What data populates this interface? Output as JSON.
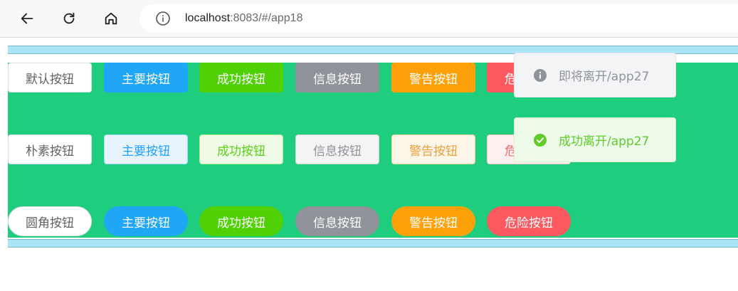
{
  "browser": {
    "url_host": "localhost",
    "url_rest": ":8083/#/app18"
  },
  "rows": [
    {
      "buttons": [
        "默认按钮",
        "主要按钮",
        "成功按钮",
        "信息按钮",
        "警告按钮",
        "危险按钮"
      ]
    },
    {
      "buttons": [
        "朴素按钮",
        "主要按钮",
        "成功按钮",
        "信息按钮",
        "警告按钮",
        "危险按钮"
      ]
    },
    {
      "buttons": [
        "圆角按钮",
        "主要按钮",
        "成功按钮",
        "信息按钮",
        "警告按钮",
        "危险按钮"
      ]
    }
  ],
  "messages": {
    "info": "即将离开/app27",
    "success": "成功离开/app27"
  },
  "colors": {
    "background_green": "#1fcd7e",
    "strip_blue": "#a9e5f7",
    "primary": "#1fa7f5",
    "success": "#4fd106",
    "info": "#909399",
    "warning": "#fda10b",
    "danger": "#fb5860"
  }
}
